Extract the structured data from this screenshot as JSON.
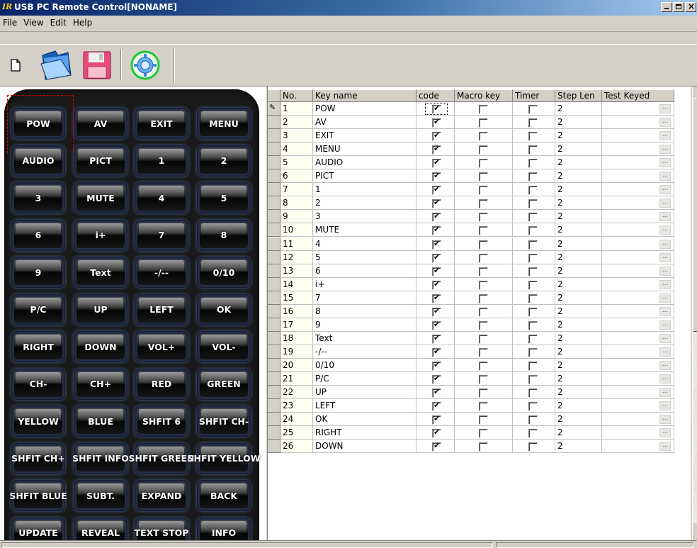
{
  "window": {
    "icon_text": "IR",
    "title": "USB PC Remote Control[NONAME]"
  },
  "menu": [
    "File",
    "View",
    "Edit",
    "Help"
  ],
  "toolbar": {
    "buttons": [
      "new-document-icon",
      "open-folder-icon",
      "save-floppy-icon",
      "settings-gear-icon"
    ]
  },
  "remote": {
    "buttons": [
      [
        "POW",
        "AV",
        "EXIT",
        "MENU"
      ],
      [
        "AUDIO",
        "PICT",
        "1",
        "2"
      ],
      [
        "3",
        "MUTE",
        "4",
        "5"
      ],
      [
        "6",
        "i+",
        "7",
        "8"
      ],
      [
        "9",
        "Text",
        "-/--",
        "0/10"
      ],
      [
        "P/C",
        "UP",
        "LEFT",
        "OK"
      ],
      [
        "RIGHT",
        "DOWN",
        "VOL+",
        "VOL-"
      ],
      [
        "CH-",
        "CH+",
        "RED",
        "GREEN"
      ],
      [
        "YELLOW",
        "BLUE",
        "SHFIT 6",
        "SHFIT CH-"
      ],
      [
        "SHFIT CH+",
        "SHFIT INFO",
        "SHFIT GREEN",
        "SHFIT YELLOW"
      ],
      [
        "SHFIT BLUE",
        "SUBT.",
        "EXPAND",
        "BACK"
      ],
      [
        "UPDATE",
        "REVEAL",
        "TEXT STOP",
        "INFO"
      ]
    ]
  },
  "grid": {
    "columns": [
      "No.",
      "Key name",
      "code",
      "Macro key",
      "Timer",
      "Step Len",
      "Test Keyed"
    ],
    "ellipsis": "...",
    "rows": [
      {
        "no": "1",
        "key": "POW",
        "code": true,
        "macro": false,
        "timer": false,
        "step": "2"
      },
      {
        "no": "2",
        "key": "AV",
        "code": true,
        "macro": false,
        "timer": false,
        "step": "2"
      },
      {
        "no": "3",
        "key": "EXIT",
        "code": true,
        "macro": false,
        "timer": false,
        "step": "2"
      },
      {
        "no": "4",
        "key": "MENU",
        "code": true,
        "macro": false,
        "timer": false,
        "step": "2"
      },
      {
        "no": "5",
        "key": "AUDIO",
        "code": true,
        "macro": false,
        "timer": false,
        "step": "2"
      },
      {
        "no": "6",
        "key": "PICT",
        "code": true,
        "macro": false,
        "timer": false,
        "step": "2"
      },
      {
        "no": "7",
        "key": "1",
        "code": true,
        "macro": false,
        "timer": false,
        "step": "2"
      },
      {
        "no": "8",
        "key": "2",
        "code": true,
        "macro": false,
        "timer": false,
        "step": "2"
      },
      {
        "no": "9",
        "key": "3",
        "code": true,
        "macro": false,
        "timer": false,
        "step": "2"
      },
      {
        "no": "10",
        "key": "MUTE",
        "code": true,
        "macro": false,
        "timer": false,
        "step": "2"
      },
      {
        "no": "11",
        "key": "4",
        "code": true,
        "macro": false,
        "timer": false,
        "step": "2"
      },
      {
        "no": "12",
        "key": "5",
        "code": true,
        "macro": false,
        "timer": false,
        "step": "2"
      },
      {
        "no": "13",
        "key": "6",
        "code": true,
        "macro": false,
        "timer": false,
        "step": "2"
      },
      {
        "no": "14",
        "key": "i+",
        "code": true,
        "macro": false,
        "timer": false,
        "step": "2"
      },
      {
        "no": "15",
        "key": "7",
        "code": true,
        "macro": false,
        "timer": false,
        "step": "2"
      },
      {
        "no": "16",
        "key": "8",
        "code": true,
        "macro": false,
        "timer": false,
        "step": "2"
      },
      {
        "no": "17",
        "key": "9",
        "code": true,
        "macro": false,
        "timer": false,
        "step": "2"
      },
      {
        "no": "18",
        "key": "Text",
        "code": true,
        "macro": false,
        "timer": false,
        "step": "2"
      },
      {
        "no": "19",
        "key": "-/--",
        "code": true,
        "macro": false,
        "timer": false,
        "step": "2"
      },
      {
        "no": "20",
        "key": "0/10",
        "code": true,
        "macro": false,
        "timer": false,
        "step": "2"
      },
      {
        "no": "21",
        "key": "P/C",
        "code": true,
        "macro": false,
        "timer": false,
        "step": "2"
      },
      {
        "no": "22",
        "key": "UP",
        "code": true,
        "macro": false,
        "timer": false,
        "step": "2"
      },
      {
        "no": "23",
        "key": "LEFT",
        "code": true,
        "macro": false,
        "timer": false,
        "step": "2"
      },
      {
        "no": "24",
        "key": "OK",
        "code": true,
        "macro": false,
        "timer": false,
        "step": "2"
      },
      {
        "no": "25",
        "key": "RIGHT",
        "code": true,
        "macro": false,
        "timer": false,
        "step": "2"
      },
      {
        "no": "26",
        "key": "DOWN",
        "code": true,
        "macro": false,
        "timer": false,
        "step": "2"
      }
    ]
  }
}
